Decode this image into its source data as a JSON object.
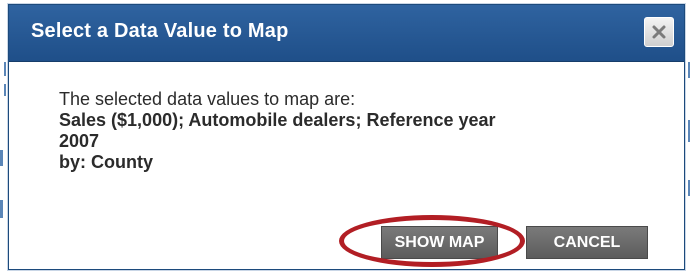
{
  "dialog": {
    "title": "Select a Data Value to Map",
    "intro": "The selected data values to map are:",
    "value_line_1": "Sales ($1,000); Automobile dealers; Reference year",
    "value_line_2": "2007",
    "value_line_3": "by: County",
    "show_map_label": "SHOW MAP",
    "cancel_label": "CANCEL"
  },
  "colors": {
    "titlebar": "#2a5c98",
    "button": "#6a6a6a",
    "highlight": "#b21e24"
  },
  "icons": {
    "close": "close-icon"
  }
}
